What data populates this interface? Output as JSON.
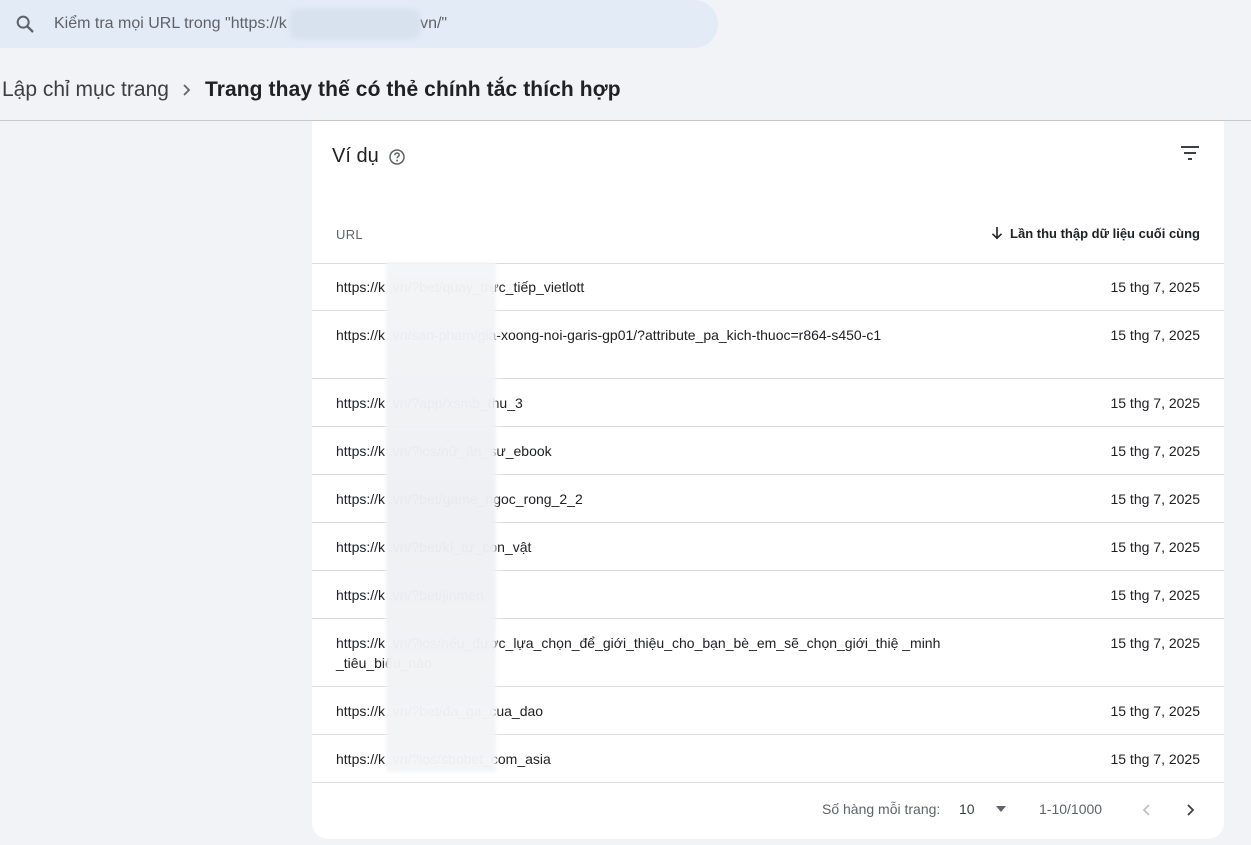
{
  "search": {
    "placeholder": "Kiểm tra mọi URL trong \"https://k                              vn/\"",
    "icon": "search-icon"
  },
  "breadcrumb": {
    "parent": "Lập chỉ mục trang",
    "current": "Trang thay thế có thẻ chính tắc thích hợp"
  },
  "card": {
    "title": "Ví dụ",
    "columns": {
      "url": "URL",
      "date": "Lần thu thập dữ liệu cuối cùng"
    },
    "rows": [
      {
        "url": "https://k                    .vn/?bet/quay_trực_tiếp_vietlott",
        "date": "15 thg 7, 2025",
        "lines": 1
      },
      {
        "url": "https://k                    .vn/san-pham/gia-xoong-noi-garis-gp01/?attribute_pa_kich-thuoc=r864-s450-c1",
        "date": "15 thg 7, 2025",
        "lines": 2
      },
      {
        "url": "https://k                    .vn/?app/xsmb_thu_3",
        "date": "15 thg 7, 2025",
        "lines": 1
      },
      {
        "url": "https://k                    .vn/?ios/nữ_ân_sư_ebook",
        "date": "15 thg 7, 2025",
        "lines": 1
      },
      {
        "url": "https://k                    .vn/?bet/game_ngoc_rong_2_2",
        "date": "15 thg 7, 2025",
        "lines": 1
      },
      {
        "url": "https://k                    .vn/?bet/kí_tự_con_vật",
        "date": "15 thg 7, 2025",
        "lines": 1
      },
      {
        "url": "https://k                    .vn/?bet/jinmen",
        "date": "15 thg 7, 2025",
        "lines": 1
      },
      {
        "url": "https://k                    .vn/?ios/nếu_được_lựa_chọn_để_giới_thiệu_cho_bạn_bè_em_sẽ_chọn_giới_thiệ                    _minh_tiêu_biểu_nào",
        "date": "15 thg 7, 2025",
        "lines": 2
      },
      {
        "url": "https://k                    .vn/?bet/đa_ga_cua_dao",
        "date": "15 thg 7, 2025",
        "lines": 1
      },
      {
        "url": "https://k                    .vn/?ios/sbobet_com_asia",
        "date": "15 thg 7, 2025",
        "lines": 1
      }
    ]
  },
  "pager": {
    "rows_per_page_label": "Số hàng mỗi trang:",
    "rows_per_page_value": "10",
    "range": "1-10/1000"
  },
  "colors": {
    "background": "#f1f3f6",
    "search_bg": "#e3ebf7",
    "card_bg": "#ffffff",
    "divider": "#dadce0",
    "text_primary": "#202124",
    "text_secondary": "#5f6368"
  }
}
